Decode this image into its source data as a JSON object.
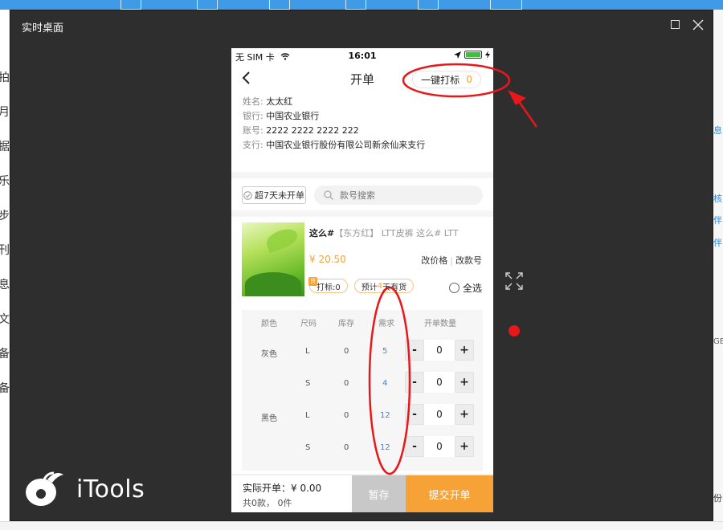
{
  "window": {
    "title": "实时桌面"
  },
  "background": {
    "left_glyphs": [
      "拍",
      "月",
      "据",
      "乐",
      "步",
      "刊",
      "息",
      "文",
      "备",
      "备"
    ],
    "right_glyphs": [
      "息",
      "核",
      "伴",
      "伴",
      "GB"
    ],
    "bottom_right_glyph": "份"
  },
  "brand": {
    "name": "iTools"
  },
  "phone": {
    "status": {
      "carrier": "无 SIM 卡",
      "time": "16:01"
    },
    "nav": {
      "title": "开单",
      "quick_tag_label": "一键打标",
      "quick_tag_count": "0"
    },
    "info": [
      {
        "label": "姓名:",
        "value": "太太红"
      },
      {
        "label": "银行:",
        "value": "中国农业银行"
      },
      {
        "label": "账号:",
        "value": "2222 2222 2222 222"
      },
      {
        "label": "支行:",
        "value": "中国农业银行股份有限公司新余仙来支行"
      }
    ],
    "filter": {
      "checkbox_label": "超7天未开单",
      "search_placeholder": "款号搜索"
    },
    "product": {
      "name_bold": "这么#",
      "name_rest": "【东方红】 LTT皮裤 这么# LTT",
      "price": "¥ 20.50",
      "link_price": "改价格",
      "link_code": "改款号",
      "tag_mark": "打标:0",
      "tag_mark_icon": "货",
      "tag_eta_prefix": "预计",
      "tag_eta_days": "4",
      "tag_eta_suffix": "天有货",
      "select_all": "全选"
    },
    "table": {
      "headers": [
        "颜色",
        "尺码",
        "库存",
        "需求",
        "开单数量"
      ],
      "rows": [
        {
          "color": "灰色",
          "size": "L",
          "stock": "0",
          "need": "5",
          "qty": "0"
        },
        {
          "color": "",
          "size": "S",
          "stock": "0",
          "need": "4",
          "qty": "0"
        },
        {
          "color": "黑色",
          "size": "L",
          "stock": "0",
          "need": "12",
          "qty": "0"
        },
        {
          "color": "",
          "size": "S",
          "stock": "0",
          "need": "12",
          "qty": "0"
        }
      ],
      "minus": "-",
      "plus": "+"
    },
    "footer": {
      "actual_label": "实际开单：",
      "actual_value": "¥ 0.00",
      "summary": "共0款，  0件",
      "save": "暂存",
      "submit": "提交开单"
    }
  },
  "colors": {
    "accent": "#f7a236",
    "need_blue": "#4a7fd6",
    "annotation_red": "#e8181a",
    "window_bg": "#2e2e2e"
  }
}
